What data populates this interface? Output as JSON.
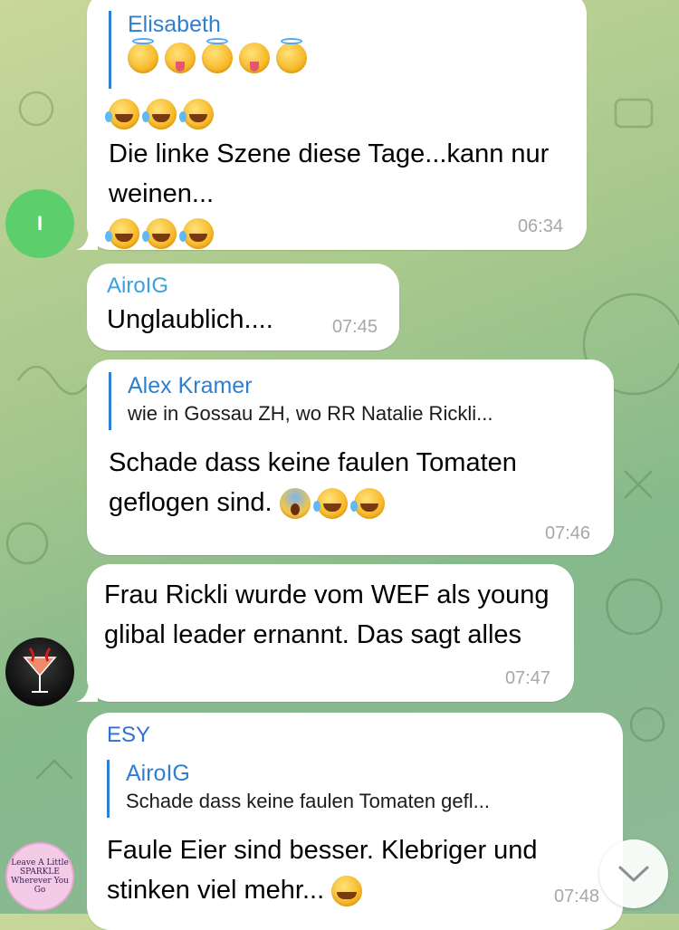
{
  "messages": [
    {
      "reply": {
        "name": "Elisabeth",
        "emojis": [
          "halo",
          "crazy",
          "halo",
          "crazy",
          "halo"
        ]
      },
      "emojis_top": [
        "laugh",
        "laugh",
        "laugh"
      ],
      "text": "Die linke Szene diese Tage...kann nur weinen...",
      "emojis_bottom": [
        "laugh",
        "laugh",
        "laugh"
      ],
      "time": "06:34"
    },
    {
      "sender": "AiroIG",
      "sender_color": "#3aa0e3",
      "text": "Unglaublich....",
      "time": "07:45"
    },
    {
      "reply": {
        "name": "Alex Kramer",
        "text": "wie in Gossau ZH, wo RR Natalie Rickli..."
      },
      "text": "Schade dass keine faulen Tomaten geflogen sind.",
      "emojis_inline": [
        "scream",
        "laugh",
        "laugh"
      ],
      "time": "07:46"
    },
    {
      "text": "Frau Rickli wurde vom WEF als young glibal leader ernannt. Das sagt alles",
      "time": "07:47"
    },
    {
      "sender": "ESY",
      "sender_color": "#2f6fd6",
      "reply": {
        "name": "AiroIG",
        "text": "Schade dass keine faulen Tomaten gefl..."
      },
      "text": "Faule Eier sind besser. Klebriger und stinken viel mehr...",
      "emojis_inline": [
        "grin"
      ],
      "time": "07:48"
    }
  ],
  "avatars": [
    {
      "letter": "I",
      "color": "#5ccf6c"
    },
    {
      "label": "cocktail-avatar"
    },
    {
      "text": "Leave A Little SPARKLE Wherever You Go"
    }
  ],
  "colors": {
    "reply_bar": "#2f7fd1",
    "time": "#a7a7ab"
  }
}
